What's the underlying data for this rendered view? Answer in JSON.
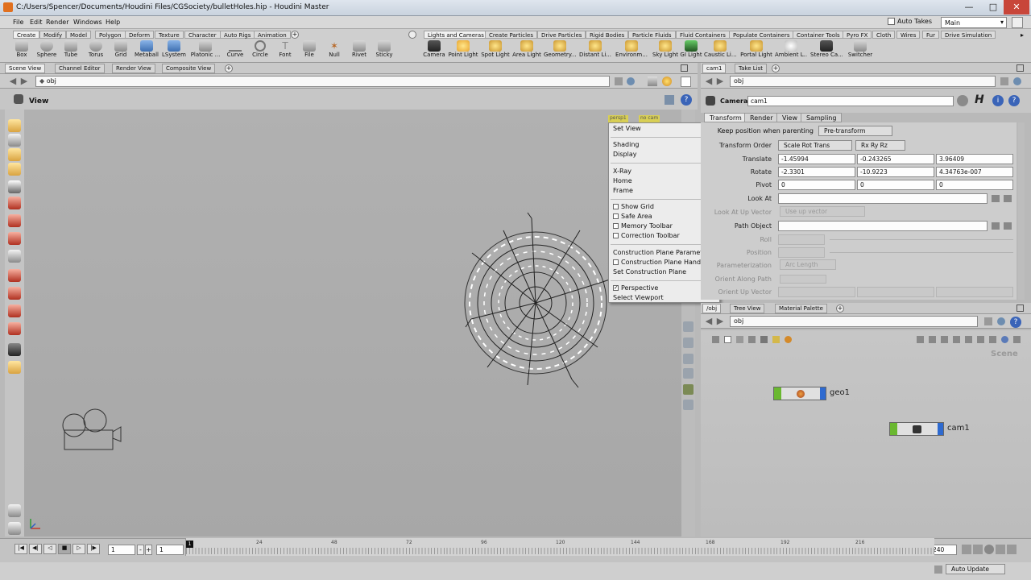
{
  "window": {
    "title": "C:/Users/Spencer/Documents/Houdini Files/CGSociety/bulletHoles.hip - Houdini Master",
    "minimize": "—",
    "maximize": "□",
    "close": "✕"
  },
  "menubar": {
    "items": [
      "File",
      "Edit",
      "Render",
      "Windows",
      "Help"
    ],
    "auto_takes": "Auto Takes",
    "desktop": "Main"
  },
  "shelf": {
    "left_tabs": [
      "Create",
      "Modify",
      "Model",
      "Polygon",
      "Deform",
      "Texture",
      "Character",
      "Auto Rigs",
      "Animation"
    ],
    "left_tools": [
      "Box",
      "Sphere",
      "Tube",
      "Torus",
      "Grid",
      "Metaball",
      "LSystem",
      "Platonic ...",
      "Curve",
      "Circle",
      "Font",
      "File",
      "Null",
      "Rivet",
      "Sticky"
    ],
    "right_tabs": [
      "Lights and Cameras",
      "Create Particles",
      "Drive Particles",
      "Rigid Bodies",
      "Particle Fluids",
      "Fluid Containers",
      "Populate Containers",
      "Container Tools",
      "Pyro FX",
      "Cloth",
      "Wires",
      "Fur",
      "Drive Simulation"
    ],
    "right_tools": [
      "Camera",
      "Point Light",
      "Spot Light",
      "Area Light",
      "Geometry...",
      "Distant Li...",
      "Environm...",
      "Sky Light",
      "GI Light",
      "Caustic Li...",
      "Portal Light",
      "Ambient L...",
      "Stereo Ca...",
      "Switcher"
    ]
  },
  "left_pane": {
    "tabs": [
      "Scene View",
      "Channel Editor",
      "Render View",
      "Composite View"
    ],
    "path": "obj",
    "view_label": "View",
    "persp": "persp1",
    "cam": "no cam"
  },
  "context_menu": {
    "group1": [
      "Set View"
    ],
    "group2": [
      "Shading",
      "Display"
    ],
    "group3": [
      "X-Ray",
      "Home",
      "Frame"
    ],
    "group4": [
      "Show Grid",
      "Safe Area",
      "Memory Toolbar",
      "Correction Toolbar"
    ],
    "group5": [
      "Construction Plane Parameters...",
      "Construction Plane Handle",
      "Set Construction Plane"
    ],
    "group6": [
      "Perspective",
      "Select Viewport"
    ],
    "perspective_key": "O",
    "select_key": "N"
  },
  "param_pane": {
    "tabs": [
      "cam1",
      "Take List"
    ],
    "path": "obj",
    "node_type": "Camera",
    "node_name": "cam1",
    "ptabs": [
      "Transform",
      "Render",
      "View",
      "Sampling"
    ],
    "keep_pos_label": "Keep position when parenting",
    "keep_pos_value": "Pre-transform",
    "transform_order_label": "Transform Order",
    "transform_order": "Scale Rot Trans",
    "rot_order": "Rx Ry Rz",
    "translate_label": "Translate",
    "translate": [
      "-1.45994",
      "-0.243265",
      "3.96409"
    ],
    "rotate_label": "Rotate",
    "rotate": [
      "-2.3301",
      "-10.9223",
      "4.34763e-007"
    ],
    "pivot_label": "Pivot",
    "pivot": [
      "0",
      "0",
      "0"
    ],
    "lookat_label": "Look At",
    "lookup_label": "Look At Up Vector",
    "lookup_value": "Use up vector",
    "path_object_label": "Path Object",
    "roll_label": "Roll",
    "position_label": "Position",
    "param_label": "Parameterization",
    "param_value": "Arc Length",
    "orient_along_label": "Orient Along Path",
    "orient_up_label": "Orient Up Vector"
  },
  "network_pane": {
    "tabs": [
      "/obj",
      "Tree View",
      "Material Palette"
    ],
    "path": "obj",
    "context": "Scene",
    "nodes": [
      {
        "name": "geo1"
      },
      {
        "name": "cam1"
      }
    ]
  },
  "timeline": {
    "ticks": [
      "1",
      "24",
      "48",
      "72",
      "96",
      "120",
      "144",
      "168",
      "192",
      "216"
    ],
    "frame": "1",
    "start": "1",
    "end": "240",
    "current_marker": "1"
  },
  "status": {
    "auto_update": "Auto Update"
  },
  "colors": {
    "viewport": "#ababab",
    "menu_bg": "#ececec",
    "node_green": "#6ab830",
    "node_blue": "#2e6ad0"
  }
}
